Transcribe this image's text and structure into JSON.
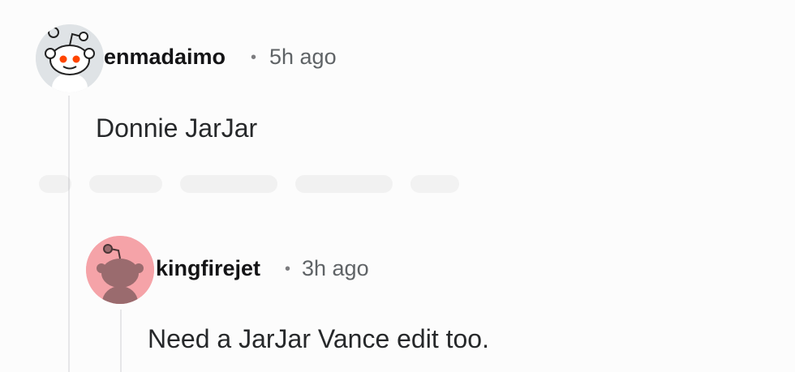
{
  "comments": [
    {
      "username": "enmadaimo",
      "separator": "•",
      "time": "5h ago",
      "text": "Donnie JarJar",
      "avatar_icon": "snoo-avatar-icon",
      "avatar_color": "#dfe3e6"
    },
    {
      "username": "kingfirejet",
      "separator": "•",
      "time": "3h ago",
      "text": "Need a JarJar Vance edit too.",
      "avatar_icon": "snoo-avatar-icon",
      "avatar_color": "#f5a3a8"
    }
  ]
}
